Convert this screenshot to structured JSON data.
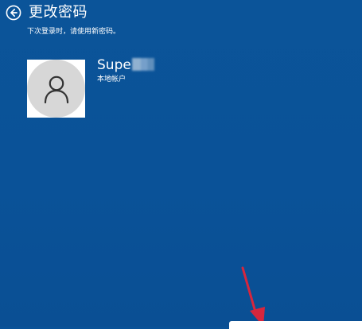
{
  "header": {
    "title": "更改密码"
  },
  "subtitle": "下次登录时，请使用新密码。",
  "account": {
    "name_visible": "Supe",
    "type": "本地帐户"
  },
  "colors": {
    "background": "#0a5298",
    "text": "#ffffff",
    "annotation_arrow": "#d7263d"
  },
  "icons": {
    "back": "back-arrow-circle-icon",
    "avatar": "user-icon"
  }
}
